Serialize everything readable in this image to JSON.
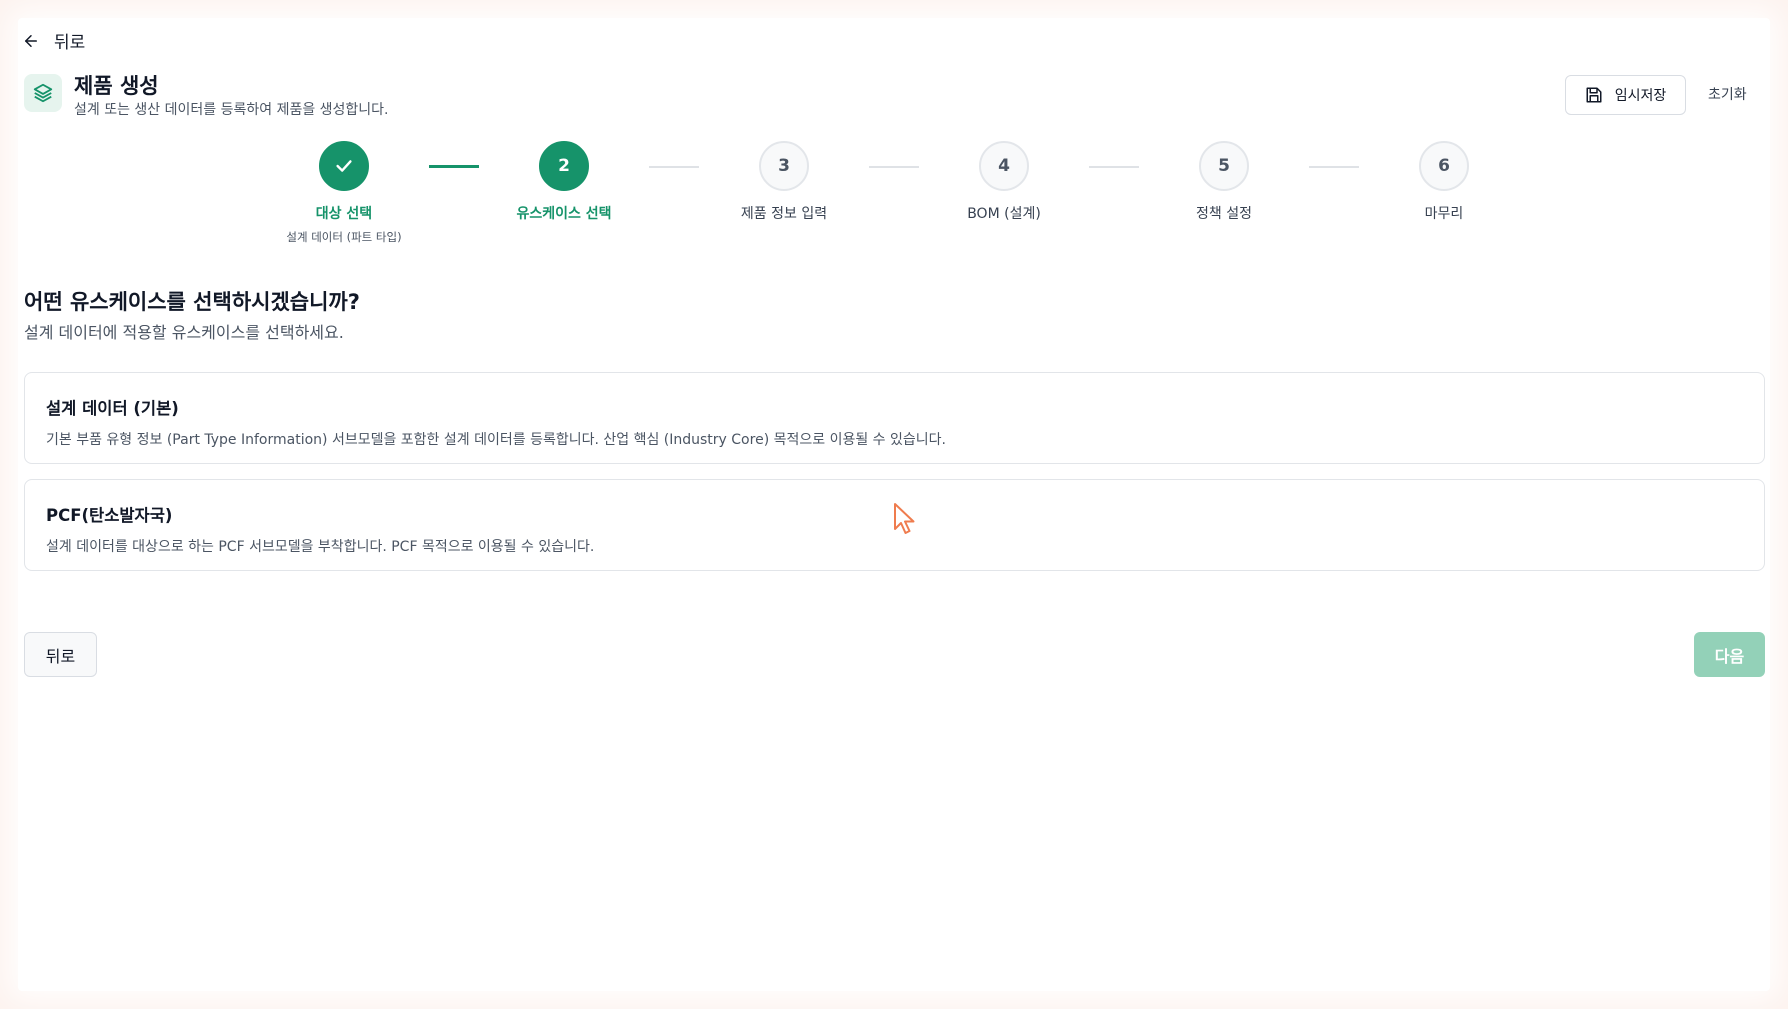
{
  "nav": {
    "back_label": "뒤로"
  },
  "header": {
    "title": "제품 생성",
    "subtitle": "설계 또는 생산 데이터를 등록하여 제품을 생성합니다.",
    "save_label": "임시저장",
    "reset_label": "초기화"
  },
  "steps": [
    {
      "number": "1",
      "label": "대상 선택",
      "sublabel": "설계 데이터 (파트 타입)",
      "status": "done"
    },
    {
      "number": "2",
      "label": "유스케이스 선택",
      "status": "active"
    },
    {
      "number": "3",
      "label": "제품 정보 입력",
      "status": "pending"
    },
    {
      "number": "4",
      "label": "BOM (설계)",
      "status": "pending"
    },
    {
      "number": "5",
      "label": "정책 설정",
      "status": "pending"
    },
    {
      "number": "6",
      "label": "마무리",
      "status": "pending"
    }
  ],
  "main": {
    "question": "어떤 유스케이스를 선택하시겠습니까?",
    "question_sub": "설계 데이터에 적용할 유스케이스를 선택하세요.",
    "options": [
      {
        "title": "설계 데이터 (기본)",
        "description": "기본 부품 유형 정보 (Part Type Information) 서브모델을 포함한 설계 데이터를 등록합니다. 산업 핵심 (Industry Core) 목적으로 이용될 수 있습니다."
      },
      {
        "title": "PCF(탄소발자국)",
        "description": "설계 데이터를 대상으로 하는 PCF 서브모델을 부착합니다. PCF 목적으로 이용될 수 있습니다."
      }
    ]
  },
  "footer": {
    "back_label": "뒤로",
    "next_label": "다음"
  },
  "colors": {
    "accent": "#16936a",
    "next_disabled": "#93d1b8"
  },
  "icons": [
    "arrow-left-icon",
    "layers-icon",
    "save-icon",
    "check-icon",
    "mouse-cursor-icon"
  ]
}
